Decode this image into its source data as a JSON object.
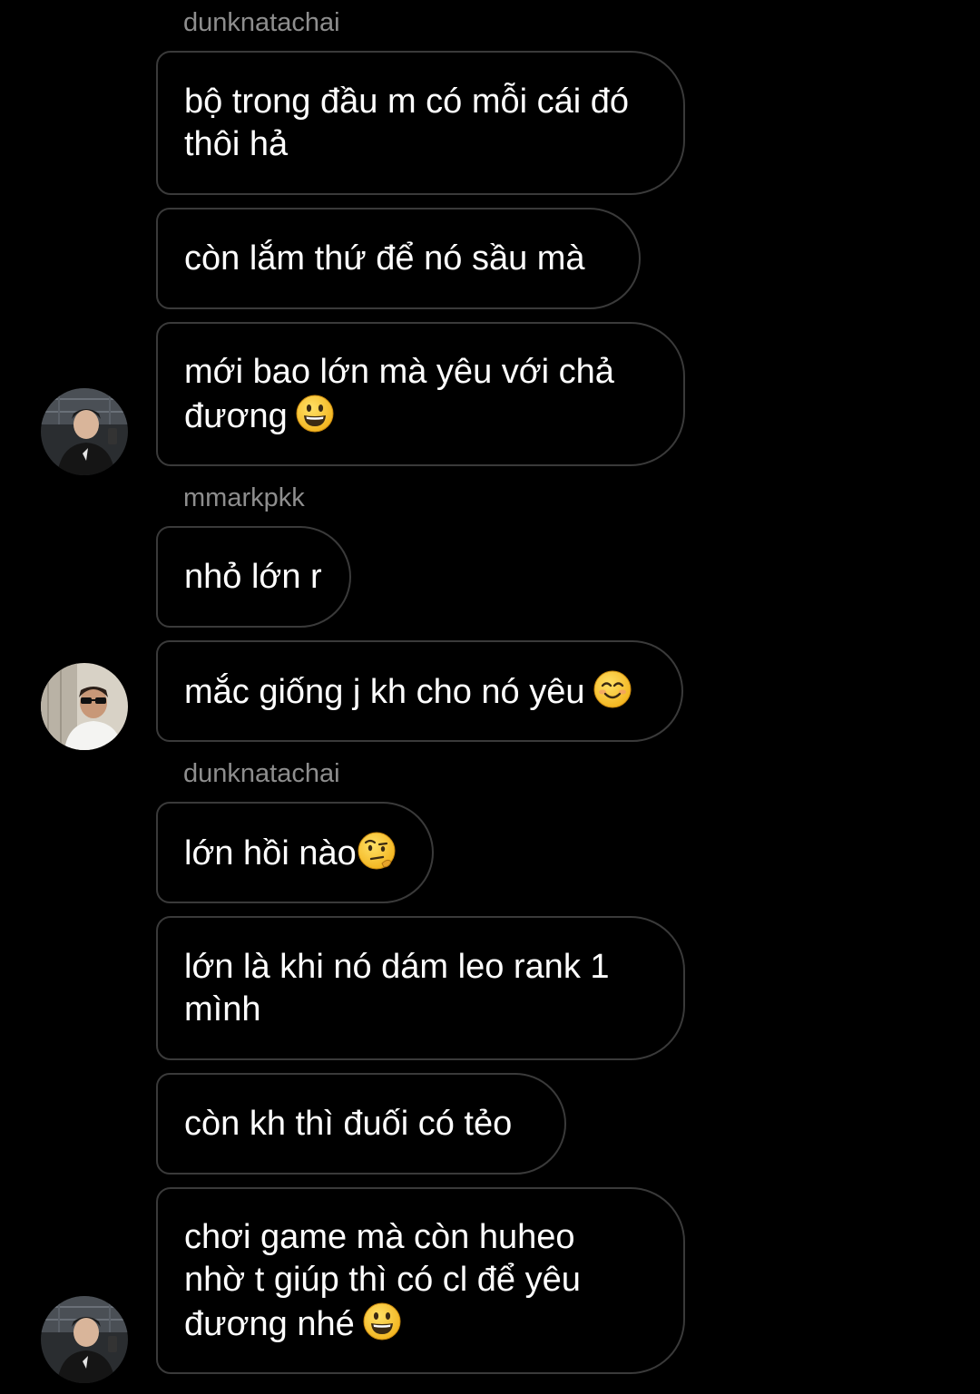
{
  "messages": [
    {
      "sender": "dunknatachai"
    },
    {
      "text": "bộ trong đầu m có mỗi cái đó\nthôi hả"
    },
    {
      "text": "còn lắm thứ để nó sầu mà"
    },
    {
      "text": "mới bao lớn mà yêu với chả\nđương",
      "emoji": "grinning-face"
    },
    {
      "sender": "mmarkpkk"
    },
    {
      "text": "nhỏ lớn r"
    },
    {
      "text": "mắc giống j kh cho nó yêu",
      "emoji": "smiling-face-with-smiling-eyes"
    },
    {
      "sender": "dunknatachai"
    },
    {
      "text": "lớn hồi nào",
      "emoji": "face-with-raised-eyebrow"
    },
    {
      "text": "lớn là khi nó dám leo rank 1\nmình"
    },
    {
      "text": "còn kh thì đuối có tẻo"
    },
    {
      "text": "chơi game mà còn huheo\nnhờ t giúp thì có cl để yêu\nđương nhé",
      "emoji": "grinning-face"
    }
  ],
  "avatars": [
    {
      "user": "dunknatachai",
      "icon": "avatar-photo"
    },
    {
      "user": "mmarkpkk",
      "icon": "avatar-photo"
    },
    {
      "user": "dunknatachai",
      "icon": "avatar-photo"
    }
  ],
  "colors": {
    "background": "#000000",
    "bubble_border": "#3a3a3a",
    "sender_text": "#8e8e8e",
    "message_text": "#ffffff",
    "emoji_yellow": "#f7c52e"
  }
}
